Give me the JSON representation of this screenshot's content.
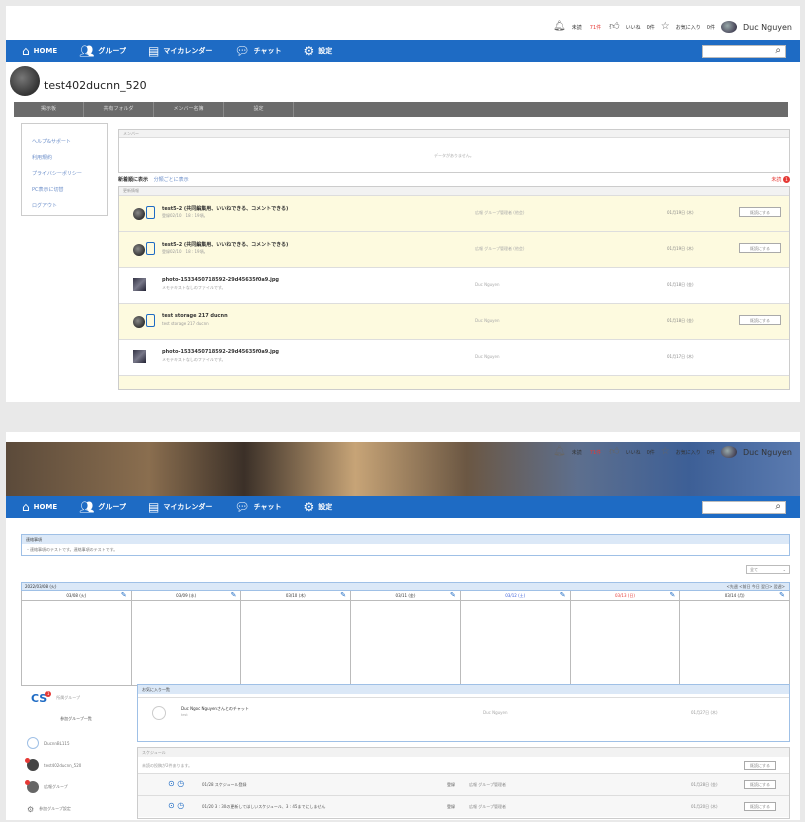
{
  "header": {
    "unread_label": "未読",
    "unread_count": "71件",
    "likes_label": "いいね",
    "likes_count": "0件",
    "fav_label": "お気に入り",
    "fav_count": "0件",
    "user_name": "Duc Nguyen"
  },
  "nav": {
    "home": "HOME",
    "group": "グループ",
    "calendar": "マイカレンダー",
    "chat": "チャット",
    "settings": "設定"
  },
  "screen1": {
    "group_name": "test402ducnn_520",
    "tabs": [
      "掲示板",
      "共有フォルダ",
      "メンバー名簿",
      "設定"
    ],
    "sidebar": [
      "ヘルプ&サポート",
      "利用規約",
      "プライバシーポリシー",
      "PC表示に切替",
      "ログアウト"
    ],
    "member_header": "メンバー",
    "member_empty": "データがありません。",
    "new_label": "新着順に表示",
    "new_link": "分類ごとに表示",
    "unread_link": "未読",
    "unread_badge": "1",
    "feed_header": "更新情報",
    "rows": [
      {
        "title": "test5-2 (共同編集用、いいねできる、コメントできる)",
        "sub": "登録02/10　18 : 19頃。",
        "who": "広報 グループ管理者 (他会)",
        "date": "01月19日 (木)",
        "btn": "既読にする"
      },
      {
        "title": "test5-2 (共同編集用、いいねできる、コメントできる)",
        "sub": "登録02/10　18 : 19頃。",
        "who": "広報 グループ管理者 (他会)",
        "date": "01月19日 (木)",
        "btn": "既読にする"
      },
      {
        "title": "photo-1533450718592-29d45635f0a9.jpg",
        "sub": "メモテキストなしのファイルです。",
        "who": "Duc Nguyen",
        "date": "01月18日 (金)",
        "btn": ""
      },
      {
        "title": "test storage 217 ducnn",
        "sub": "test storage 217 ducnn",
        "who": "Duc Nguyen",
        "date": "01月18日 (金)",
        "btn": "既読にする"
      },
      {
        "title": "photo-1533450718592-29d45635f0a9.jpg",
        "sub": "メモテキストなしのファイルです。",
        "who": "Duc Nguyen",
        "date": "01月17日 (木)",
        "btn": ""
      }
    ]
  },
  "screen2": {
    "notice_header": "連絡事項",
    "notice_body": "・連絡事項のテストです。連絡事項のテストです。",
    "select_value": "全て",
    "cal_date": "2022/03/08 (火)",
    "cal_nav": "<先週 <前日 今日 翌日> 翌週>",
    "days": [
      {
        "label": "03/08 (火)",
        "color": "#333"
      },
      {
        "label": "03/09 (水)",
        "color": "#333"
      },
      {
        "label": "03/10 (木)",
        "color": "#333"
      },
      {
        "label": "03/11 (金)",
        "color": "#333"
      },
      {
        "label": "03/12 (土)",
        "color": "#3b5fd9"
      },
      {
        "label": "03/13 (日)",
        "color": "#e53935"
      },
      {
        "label": "03/14 (月)",
        "color": "#333"
      }
    ],
    "cs_label": "CS",
    "cs_badge": "1",
    "cs_sub": "所属グループ",
    "group_list_header": "参加グループ一覧",
    "groups": [
      "DucnnBL115",
      "test402ducnn_520",
      "広報グループ",
      "参加グループ設定"
    ],
    "fav_header": "お気に入り一覧",
    "fav_title": "Duc Ngoc Nguyenさんとのチャット",
    "fav_sub": "test",
    "fav_who": "Duc Nguyen",
    "fav_date": "01月27日 (木)",
    "sched_header": "スケジュール",
    "sched_note": "未読の投稿が2件あります。",
    "sched_btn": "既読にする",
    "sched_rows": [
      {
        "text": "01/28 スケジュール登録",
        "s1": "登録",
        "s2": "広報 グループ管理者",
        "date": "01月28日 (金)",
        "btn": "既読にする"
      },
      {
        "text": "01/20 3 : 30の更新してほしいスケジュール、3 : 45までにしません",
        "s1": "登録",
        "s2": "広報 グループ管理者",
        "date": "01月20日 (木)",
        "btn": "既読にする"
      }
    ]
  }
}
